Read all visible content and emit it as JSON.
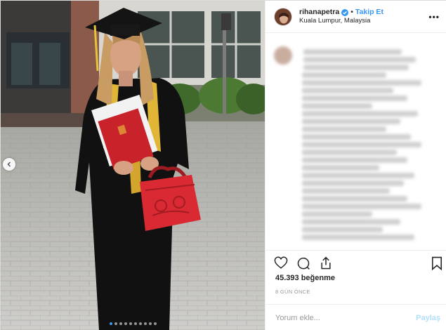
{
  "post": {
    "username": "rihanapetra",
    "separator": "•",
    "follow_label": "Takip Et",
    "location": "Kuala Lumpur, Malaysia",
    "more_label": "•••",
    "likes": "45.393 beğenme",
    "time": "8 GÜN ÖNCE",
    "carousel_slides": 10,
    "active_slide": 1
  },
  "comment": {
    "placeholder": "Yorum ekle...",
    "post_label": "Paylaş"
  },
  "icons": {
    "verified": "verified-badge-icon",
    "like": "heart-icon",
    "comment": "comment-icon",
    "share": "share-icon",
    "save": "bookmark-icon",
    "prev": "chevron-left-icon"
  },
  "colors": {
    "accent": "#3897f0",
    "text": "#262626",
    "muted": "#999999",
    "post_disabled": "#b2dffc"
  }
}
